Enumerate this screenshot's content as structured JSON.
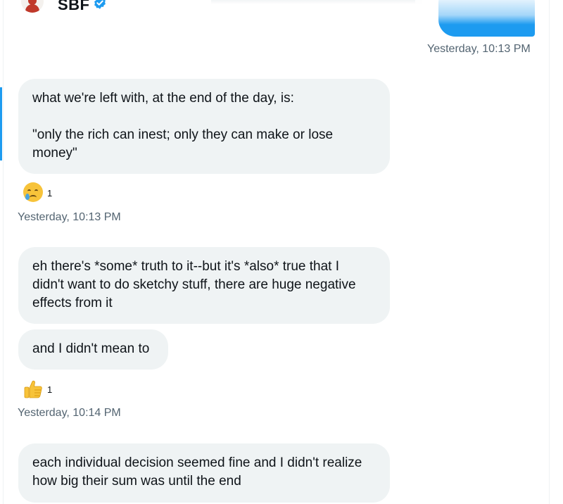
{
  "header": {
    "username": "SBF"
  },
  "timestamps": {
    "outgoing": "Yesterday, 10:13 PM",
    "first_group": "Yesterday, 10:13 PM",
    "second_group": "Yesterday, 10:14 PM"
  },
  "messages": [
    {
      "lines": [
        "what we're left with, at the end of the day, is:"
      ],
      "lines_after_gap": [
        "\"only the rich can inest; only they can make or lose",
        "money\""
      ]
    },
    {
      "lines": [
        "eh there's *some* truth to it--but it's *also* true that I",
        "didn't want to do sketchy stuff, there are huge negative",
        "effects from it"
      ]
    },
    {
      "lines": [
        "and I didn't mean to"
      ]
    },
    {
      "lines": [
        "each individual decision seemed fine and I didn't realize",
        "how big their sum was until the end"
      ]
    }
  ],
  "reactions": [
    {
      "icon": "crying-face-icon",
      "count": "1"
    },
    {
      "icon": "thumbs-up-icon",
      "count": "1"
    }
  ],
  "colors": {
    "accent": "#1d9bf0",
    "bubble": "#eff3f4",
    "meta_text": "#536471"
  }
}
